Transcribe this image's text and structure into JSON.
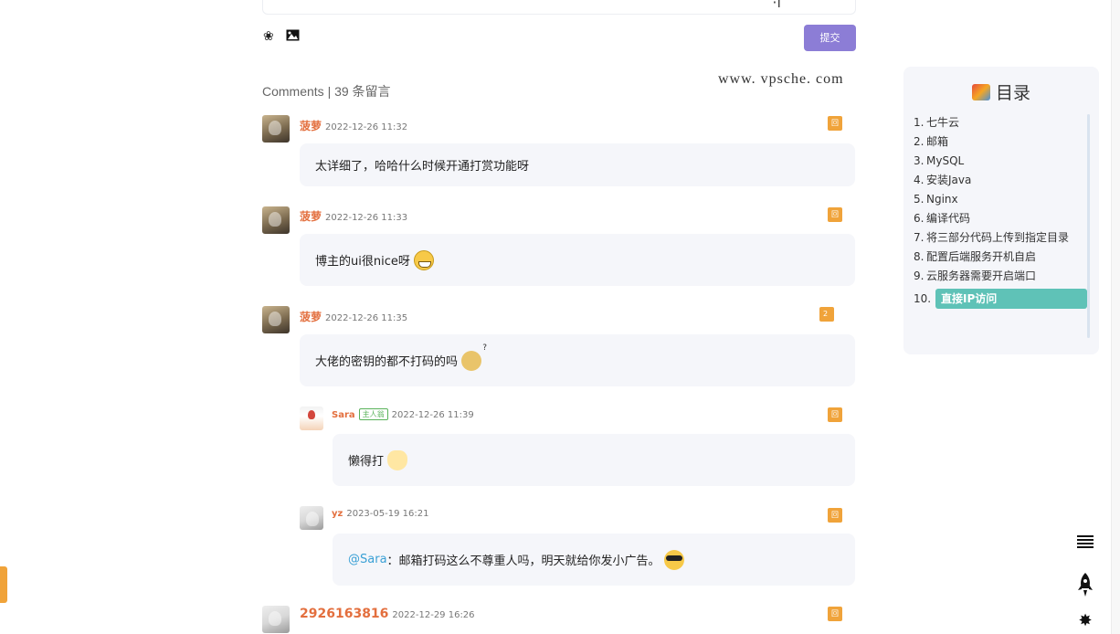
{
  "editor": {
    "submit_label": "提交",
    "deco": "·ĩ  ⌒",
    "tools": [
      {
        "icon": "emoji-smile-icon"
      },
      {
        "icon": "image-icon"
      }
    ]
  },
  "watermark": "www. vpsche. com",
  "comments": {
    "title": "Comments | 39 条留言",
    "items": [
      {
        "author": "菠萝",
        "time": "2022-12-26 11:32",
        "reply": "回复",
        "text": "太详细了，哈哈什么时候开通打赏功能呀",
        "emoji": ""
      },
      {
        "author": "菠萝",
        "time": "2022-12-26 11:33",
        "reply": "回复",
        "text": "博主的ui很nice呀",
        "emoji": "grin-icon"
      },
      {
        "author": "菠萝",
        "time": "2022-12-26 11:35",
        "reply": "2 回复",
        "text": "大佬的密钥的都不打码的吗",
        "emoji": "thinking-icon"
      },
      {
        "author": "Sara",
        "owner_tag": "主人翁",
        "time": "2022-12-26 11:39",
        "reply": "回复",
        "text": "懒得打",
        "emoji": "lazy-icon"
      },
      {
        "author": "yz",
        "time": "2023-05-19 16:21",
        "reply": "回复",
        "mention": "@Sara",
        "text": "：邮箱打码这么不尊重人吗，明天就给你发小广告。",
        "emoji": "cool-sunglasses-icon"
      },
      {
        "author": "2926163816",
        "time": "2022-12-29 16:26",
        "reply": "回复"
      }
    ]
  },
  "toc": {
    "title": "目录",
    "items": [
      {
        "num": "1.",
        "label": "七牛云"
      },
      {
        "num": "2.",
        "label": "邮箱"
      },
      {
        "num": "3.",
        "label": "MySQL"
      },
      {
        "num": "4.",
        "label": "安装Java"
      },
      {
        "num": "5.",
        "label": "Nginx"
      },
      {
        "num": "6.",
        "label": "编译代码"
      },
      {
        "num": "7.",
        "label": "将三部分代码上传到指定目录"
      },
      {
        "num": "8.",
        "label": "配置后端服务开机自启"
      },
      {
        "num": "9.",
        "label": "云服务器需要开启端口"
      },
      {
        "num": "10.",
        "label": "直接IP访问",
        "active": true
      }
    ]
  },
  "floating": {
    "icons": [
      "menu-list-icon",
      "rocket-icon",
      "settings-gear-icon"
    ]
  },
  "colors": {
    "accent": "#8c7dd6",
    "author": "#e36f3e",
    "reply": "#f0a33a",
    "toc_active": "#5fc2b7"
  }
}
